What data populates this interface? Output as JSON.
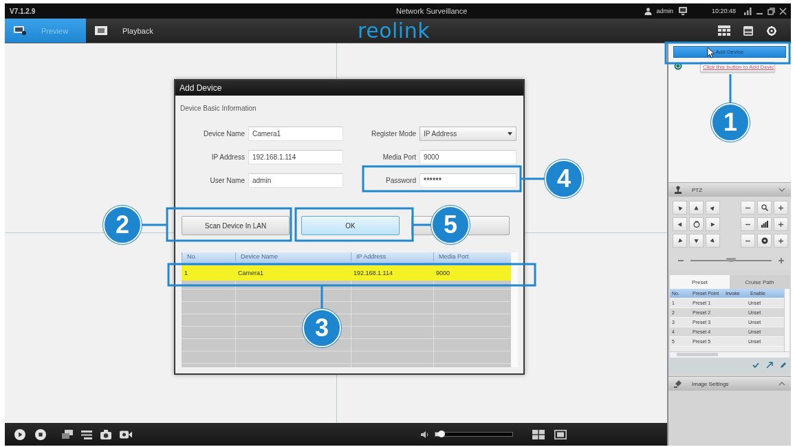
{
  "title_bar": {
    "version": "V7.1.2.9",
    "title": "Network Surveillance",
    "user": "admin",
    "time": "10:20:48"
  },
  "tabs": [
    {
      "label": "Preview",
      "selected": true
    },
    {
      "label": "Playback",
      "selected": false
    }
  ],
  "logo": "reolink",
  "dialog": {
    "title": "Add Device",
    "section": "Device Basic Information",
    "fields": [
      {
        "label": "Device Name",
        "value": "Camera1",
        "kind": "text"
      },
      {
        "label": "Register Mode",
        "value": "IP Address",
        "kind": "select"
      },
      {
        "label": "IP Address",
        "value": "192.168.1.114",
        "kind": "text"
      },
      {
        "label": "Media Port",
        "value": "9000",
        "kind": "text"
      },
      {
        "label": "User Name",
        "value": "admin",
        "kind": "text"
      },
      {
        "label": "Password",
        "value": "******",
        "kind": "password"
      }
    ],
    "buttons": [
      {
        "label": "Scan Device In LAN",
        "default": false
      },
      {
        "label": "OK",
        "default": true
      },
      {
        "default": false
      }
    ],
    "table": {
      "columns": [
        "No.",
        "Device Name",
        "IP Address",
        "Media Port"
      ],
      "rows": [
        {
          "cells": [
            "1",
            "Camera1",
            "192.168.1.114",
            "9000"
          ],
          "selected": true
        }
      ]
    }
  },
  "right_panel": {
    "add_button": "Add Device",
    "tooltip": "Click this button to Add Devic",
    "ptz": {
      "title": "PTZ",
      "speed": {
        "level": 0.5
      }
    },
    "preset_tabs": [
      {
        "label": "Preset",
        "selected": true
      },
      {
        "label": "Cruise Path",
        "selected": false
      }
    ],
    "preset_table": {
      "columns": [
        "No.",
        "Preset Point",
        "Invoke",
        "Enable"
      ],
      "rows": [
        {
          "cells": [
            "1",
            "Preset 1",
            "Unset"
          ]
        },
        {
          "cells": [
            "2",
            "Preset 2",
            "Unset"
          ]
        },
        {
          "cells": [
            "3",
            "Preset 3",
            "Unset"
          ]
        },
        {
          "cells": [
            "4",
            "Preset 4",
            "Unset"
          ]
        },
        {
          "cells": [
            "5",
            "Preset 5",
            "Unset"
          ]
        }
      ]
    },
    "image_settings": "Image Settings"
  },
  "bottom_bar": {
    "volume": {
      "level": 0.08
    }
  },
  "callouts": [
    {
      "number": "1"
    },
    {
      "number": "2"
    },
    {
      "number": "3"
    },
    {
      "number": "4"
    },
    {
      "number": "5"
    }
  ]
}
